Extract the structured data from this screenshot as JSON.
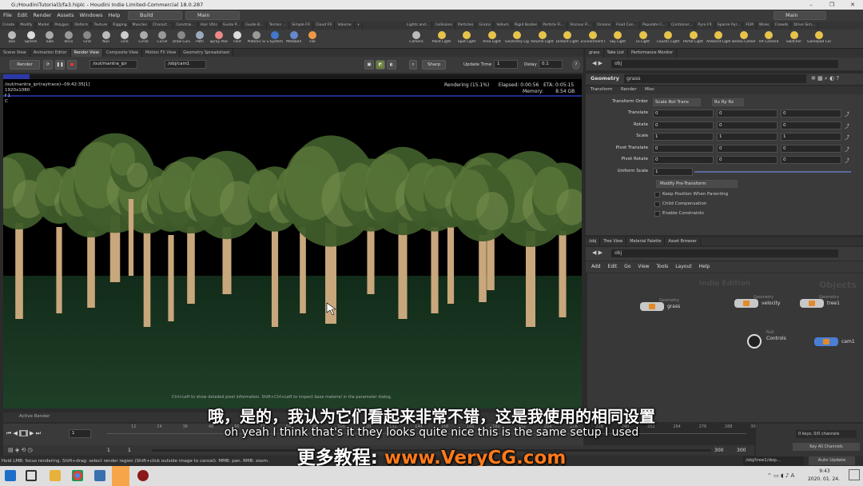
{
  "app": {
    "title": "G:/HoudiniTutorial3/fa3.hiplc - Houdini Indie Limited-Commercial 18.0.287",
    "menus": [
      "File",
      "Edit",
      "Render",
      "Assets",
      "Windows",
      "Help"
    ],
    "desktop_build": "Build",
    "desktop_main": "Main",
    "desktop_right": "Main"
  },
  "shelf_tabs_left": [
    "Create",
    "Modify",
    "Model",
    "Polygon",
    "Deform",
    "Texture",
    "Rigging",
    "Muscles",
    "Charact...",
    "Constrai...",
    "Hair Utils",
    "Guide P...",
    "Guide B...",
    "Terrain ...",
    "Simple FX",
    "Cloud FX",
    "Volume"
  ],
  "shelf_tabs_right": [
    "Lights and...",
    "Collisions",
    "Particles",
    "Grains",
    "Vellum",
    "Rigid Bodies",
    "Particle Fl...",
    "Viscous Fl...",
    "Oceans",
    "Fluid Con...",
    "Populate C...",
    "Container...",
    "Pyro FX",
    "Sparse Pyr...",
    "FEM",
    "Wires",
    "Crowds",
    "Drive Sim..."
  ],
  "shelf_tools_left": [
    "Box",
    "Sphere",
    "Tube",
    "Torus",
    "Grid",
    "Null",
    "Line",
    "Circle",
    "Curve",
    "Draw Curve",
    "Path",
    "Spray Paint",
    "Font",
    "Platonic Solids",
    "L-System",
    "Metaball",
    "File"
  ],
  "shelf_tools_right": [
    "Camera",
    "Point Light",
    "Spot Light",
    "Area Light",
    "Geometry Light",
    "Volume Light",
    "Distant Light",
    "Environment Light",
    "Sky Light",
    "GI Light",
    "Caustic Light",
    "Portal Light",
    "Ambient Light",
    "Stereo Camera",
    "VR Camera",
    "Switcher",
    "Gamepad Camera"
  ],
  "view_tabs": [
    "Scene View",
    "Animation Editor",
    "Render View",
    "Composite View",
    "Motion FX View",
    "Geometry Spreadsheet"
  ],
  "render_toolbar": {
    "render_button": "Render",
    "rop_path": "/out/mantra_ipr",
    "camera_path": "/obj/cam1",
    "sharp": "Sharp",
    "update_time_label": "Update Time",
    "update_time_value": "1",
    "delay_label": "Delay",
    "delay_value": "0.1"
  },
  "render_view": {
    "image_label": "/out/mantra_ipr(raytrace)--09:42:35[1]",
    "resolution": "1920x1080",
    "channel": "f 1",
    "channel_c": "C",
    "rendering": "Rendering (15.1%)",
    "elapsed": "Elapsed: 0:00:56",
    "eta": "ETA: 0:05:15",
    "memory_label": "Memory:",
    "memory_value": "8.54 GB",
    "progress_percent": 15.1,
    "hint": "Ctrl+Left to show detailed pixel information. Shift+Ctrl+Left to inspect base material in the parameter dialog.",
    "bottom_tab": "Active Render"
  },
  "timeline": {
    "frame": "1",
    "range_start": "1",
    "range_start2": "1",
    "range_end": "300",
    "range_end2": "300",
    "ticks": [
      "12",
      "24",
      "36",
      "48",
      "60",
      "72",
      "84",
      "96",
      "108",
      "120",
      "132",
      "144",
      "156",
      "168",
      "180",
      "192",
      "204",
      "216",
      "228",
      "240",
      "252",
      "264",
      "276",
      "288",
      "300"
    ],
    "keys": "0 keys, 0/0 channels",
    "key_all": "Key All Channels",
    "auto_update": "Auto Update",
    "obj_path": "/obj/tree1/dop..."
  },
  "status_line": "Hold LMB: focus rendering. Shift+drag: select render region (Shift+click outside image to cancel). MMB: pan. RMB: zoom.",
  "params": {
    "tabs": [
      "grass",
      "Take List",
      "Performance Monitor"
    ],
    "path": "obj",
    "node_type": "Geometry",
    "node_name": "grass",
    "subtabs": [
      "Transform",
      "Render",
      "Misc"
    ],
    "transform_order_label": "Transform Order",
    "transform_order": "Scale Rot Trans",
    "rot_order": "Rx Ry Rz",
    "rows": [
      {
        "label": "Translate",
        "values": [
          "0",
          "0",
          "0"
        ]
      },
      {
        "label": "Rotate",
        "values": [
          "0",
          "0",
          "0"
        ]
      },
      {
        "label": "Scale",
        "values": [
          "1",
          "1",
          "1"
        ]
      },
      {
        "label": "Pivot Translate",
        "values": [
          "0",
          "0",
          "0"
        ]
      },
      {
        "label": "Pivot Rotate",
        "values": [
          "0",
          "0",
          "0"
        ]
      }
    ],
    "uniform_scale_label": "Uniform Scale",
    "uniform_scale": "1",
    "modify_pre_transform": "Modify Pre-Transform",
    "checks": [
      "Keep Position When Parenting",
      "Child Compensation",
      "Enable Constraints"
    ]
  },
  "network": {
    "tabs": [
      "/obj",
      "Tree View",
      "Material Palette",
      "Asset Browser"
    ],
    "path": "obj",
    "menu": [
      "Add",
      "Edit",
      "Go",
      "View",
      "Tools",
      "Layout",
      "Help"
    ],
    "watermark_left": "Indie Edition",
    "watermark_right": "Objects",
    "nodes": [
      {
        "type": "Geometry",
        "name": "grass",
        "color": "#c8c8c8"
      },
      {
        "type": "Geometry",
        "name": "velocity",
        "color": "#c8c8c8"
      },
      {
        "type": "Geometry",
        "name": "tree1",
        "color": "#c8c8c8"
      },
      {
        "type": "Null",
        "name": "Controls",
        "color": "#222222"
      },
      {
        "type": "",
        "name": "cam1",
        "color": "#4a7fd1"
      }
    ]
  },
  "subtitles": {
    "chinese": "哦，是的，我认为它们看起来非常不错，这是我使用的相同设置",
    "english": "oh yeah I think that's it they looks quite nice this is the same setup I used",
    "promo_prefix": "更多教程:",
    "promo_url": "www.VeryCG.com"
  },
  "taskbar": {
    "time": "9:43",
    "date": "2020. 01. 24."
  },
  "colors": {
    "accent": "#2b39a8",
    "grass": "#1f3f27",
    "promo": "#ff7a1a"
  }
}
